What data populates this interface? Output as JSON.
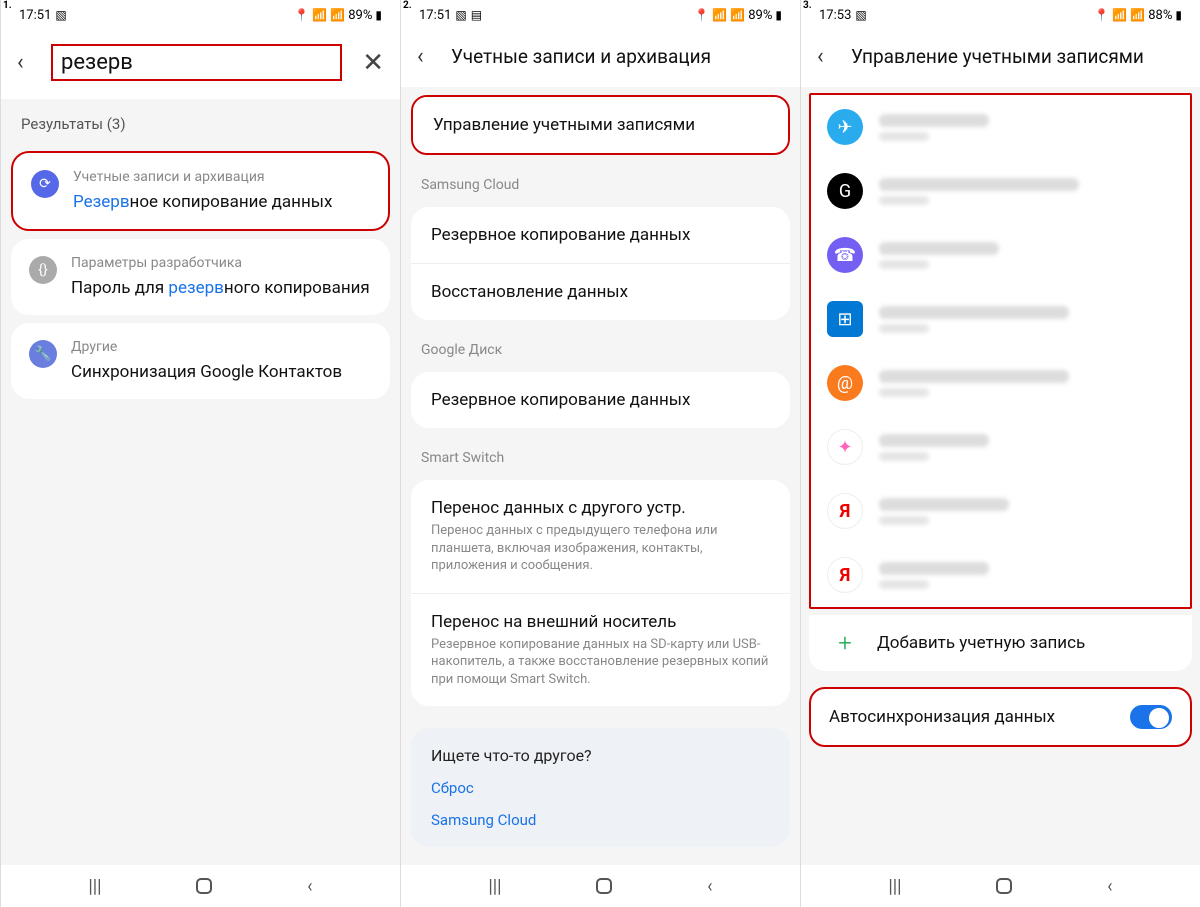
{
  "pane1": {
    "step": "1.",
    "status": {
      "time": "17:51",
      "battery": "89%"
    },
    "search_value": "резерв",
    "results_label": "Результаты (3)",
    "r1": {
      "category": "Учетные записи и архивация",
      "title_hl": "Резерв",
      "title_rest": "ное копирование данных"
    },
    "r2": {
      "category": "Параметры разработчика",
      "title_pre": "Пароль для ",
      "title_hl": "резерв",
      "title_post": "ного копирования"
    },
    "r3": {
      "category": "Другие",
      "title": "Синхронизация Google Контактов"
    }
  },
  "pane2": {
    "step": "2.",
    "status": {
      "time": "17:51",
      "battery": "89%"
    },
    "title": "Учетные записи и архивация",
    "manage": "Управление учетными записями",
    "sect_cloud": "Samsung Cloud",
    "cloud_backup": "Резервное копирование данных",
    "cloud_restore": "Восстановление данных",
    "sect_gdrive": "Google Диск",
    "gdrive_backup": "Резервное копирование данных",
    "sect_switch": "Smart Switch",
    "sw1_title": "Перенос данных с другого устр.",
    "sw1_sub": "Перенос данных с предыдущего телефона или планшета, включая изображения, контакты, приложения и сообщения.",
    "sw2_title": "Перенос на внешний носитель",
    "sw2_sub": "Резервное копирование данных на SD-карту или USB-накопитель, а также восстановление резервных копий при помощи Smart Switch.",
    "looking_title": "Ищете что-то другое?",
    "looking_link1": "Сброс",
    "looking_link2": "Samsung Cloud"
  },
  "pane3": {
    "step": "3.",
    "status": {
      "time": "17:53",
      "battery": "88%"
    },
    "title": "Управление учетными записями",
    "add": "Добавить учетную запись",
    "sync": "Автосинхронизация данных"
  }
}
